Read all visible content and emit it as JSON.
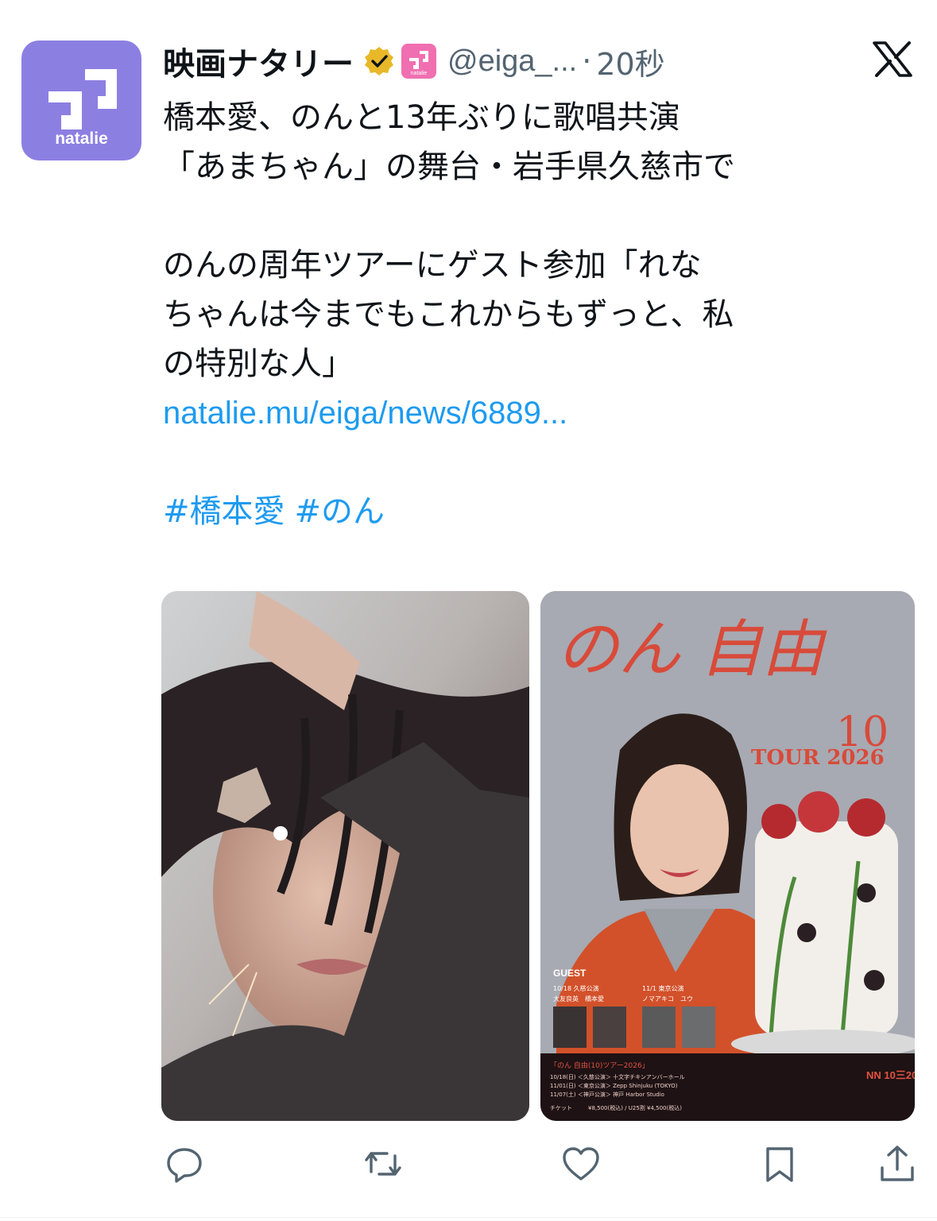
{
  "avatar": {
    "label": "natalie"
  },
  "header": {
    "display_name": "映画ナタリー",
    "app_badge_label": "natalie",
    "handle": "@eiga_...",
    "separator": "·",
    "time": "20秒"
  },
  "tweet": {
    "lines": [
      "橋本愛、のんと13年ぶりに歌唱共演",
      "「あまちゃん」の舞台・岩手県久慈市で",
      "",
      "のんの周年ツアーにゲスト参加「れな",
      "ちゃんは今までもこれからもずっと、私",
      "の特別な人」"
    ],
    "link": "natalie.mu/eiga/news/6889...",
    "hashtags": [
      "#橋本愛",
      "#のん"
    ]
  },
  "poster": {
    "title": "のん 自由",
    "number": "10",
    "tour": "TOUR 2026",
    "guest": "GUEST",
    "show1": "10/18 久慈公演",
    "show1_guests": "大友良英　橋本愛",
    "show2": "11/1 東京公演",
    "show2_guests": "ノマアキコ　ユウ",
    "tour_title": "「のん 自由(10)ツアー2026」",
    "date1": "10/18(日) ＜久慈公演＞ 十文字チキンアンバーホール",
    "date2": "11/01(日) ＜東京公演＞ Zepp Shinjuku (TOKYO)",
    "date3": "11/07(土) ＜神戸公演＞ 神戸 Harbor Studio",
    "ticket": "チケット",
    "price": "¥8,500(税込) / U25割 ¥4,500(税込)",
    "logo": "NN 10三20"
  },
  "colors": {
    "link": "#1d9bf0",
    "secondary_text": "#536471",
    "avatar_bg": "#8c7fe2",
    "verified_gold": "#e8b829",
    "app_badge": "#f06fb1"
  },
  "icons": [
    "reply-icon",
    "repost-icon",
    "like-icon",
    "bookmark-icon",
    "share-icon",
    "x-logo-icon",
    "verified-badge-icon"
  ]
}
